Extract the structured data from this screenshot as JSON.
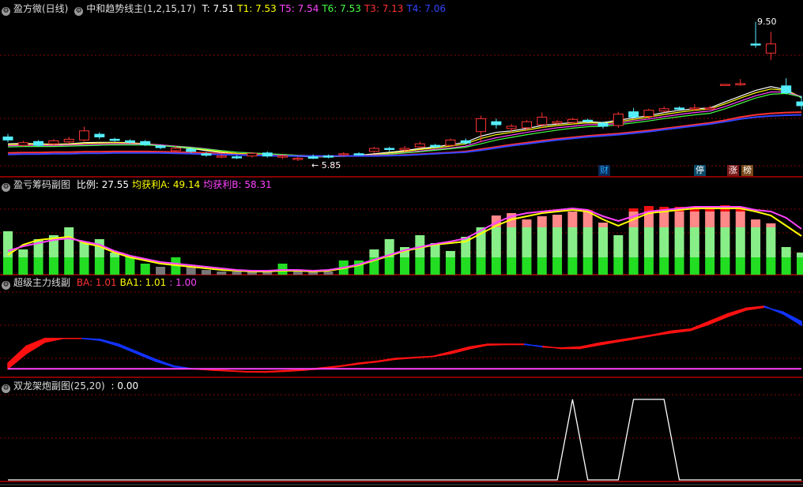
{
  "panel1": {
    "title": "盈方微(日线)",
    "indicator": "中和趋势线主(1,2,15,17)",
    "values": [
      {
        "label": "T: 7.51",
        "color": "#ffffff"
      },
      {
        "label": "T1: 7.53",
        "color": "#ffff00"
      },
      {
        "label": "T5: 7.54",
        "color": "#ff44ff"
      },
      {
        "label": "T6: 7.53",
        "color": "#44ff44"
      },
      {
        "label": "T3: 7.13",
        "color": "#ff3333"
      },
      {
        "label": "T4: 7.06",
        "color": "#3344ff"
      }
    ],
    "high_label": "9.50",
    "low_label": "5.85",
    "tags": [
      {
        "text": "财",
        "color": "#22aaff",
        "bg": "#0a2a55"
      },
      {
        "text": "停",
        "color": "#ffffff",
        "bg": "#0a4a6a"
      },
      {
        "text": "涨",
        "color": "#ffffff",
        "bg": "#7a1a1a"
      },
      {
        "text": "榜",
        "color": "#ffffff",
        "bg": "#7a4a1a"
      }
    ]
  },
  "panel2": {
    "title": "盈亏筹码副图",
    "values": [
      {
        "label": "比例: 27.55",
        "color": "#ffffff"
      },
      {
        "label": "均获利A: 49.14",
        "color": "#ffff00"
      },
      {
        "label": "均获利B: 58.31",
        "color": "#ff44ff"
      }
    ]
  },
  "panel3": {
    "title": "超级主力线副",
    "values": [
      {
        "label": "BA: 1.01",
        "color": "#ff3333"
      },
      {
        "label": "BA1: 1.01",
        "color": "#ffff00"
      },
      {
        "label": ": 1.00",
        "color": "#ff44ff"
      }
    ]
  },
  "panel4": {
    "title": "双龙架炮副图(25,20)",
    "values": [
      {
        "label": ": 0.00",
        "color": "#ffffff"
      }
    ]
  },
  "colors": {
    "up": "#ff3333",
    "down": "#55eeff",
    "grid": "#8a0000",
    "border": "#b00000",
    "ma_white": "#ffffff",
    "ma_yellow": "#ffff00",
    "ma_magenta": "#ff44ff",
    "ma_green": "#44ff44",
    "ma_red": "#ff3333",
    "ma_blue": "#3344ff"
  },
  "chart_data": [
    {
      "type": "candlestick",
      "title": "盈方微(日线)",
      "ylim": [
        5.6,
        9.7
      ],
      "high": 9.5,
      "low": 5.85,
      "candles": [
        [
          6.48,
          6.4,
          6.56,
          6.34
        ],
        [
          6.26,
          6.33,
          6.38,
          6.22
        ],
        [
          6.36,
          6.26,
          6.4,
          6.22
        ],
        [
          6.3,
          6.38,
          6.42,
          6.26
        ],
        [
          6.35,
          6.42,
          6.48,
          6.3
        ],
        [
          6.4,
          6.64,
          6.75,
          6.36
        ],
        [
          6.55,
          6.48,
          6.6,
          6.42
        ],
        [
          6.42,
          6.4,
          6.46,
          6.36
        ],
        [
          6.38,
          6.34,
          6.42,
          6.3
        ],
        [
          6.36,
          6.28,
          6.4,
          6.24
        ],
        [
          6.24,
          6.2,
          6.28,
          6.16
        ],
        [
          6.12,
          6.18,
          6.24,
          6.08
        ],
        [
          6.16,
          6.1,
          6.2,
          6.06
        ],
        [
          6.04,
          6.0,
          6.08,
          5.96
        ],
        [
          5.96,
          5.98,
          6.02,
          5.92
        ],
        [
          5.96,
          5.93,
          6.0,
          5.9
        ],
        [
          5.98,
          6.05,
          6.08,
          5.94
        ],
        [
          6.06,
          5.98,
          6.1,
          5.94
        ],
        [
          5.96,
          5.98,
          6.02,
          5.9
        ],
        [
          5.9,
          5.92,
          5.96,
          5.85
        ],
        [
          5.96,
          5.92,
          6.02,
          5.9
        ],
        [
          5.98,
          5.95,
          6.02,
          5.92
        ],
        [
          6.02,
          6.04,
          6.08,
          5.98
        ],
        [
          6.04,
          6.02,
          6.08,
          6.0
        ],
        [
          6.1,
          6.18,
          6.22,
          6.06
        ],
        [
          6.18,
          6.16,
          6.22,
          6.1
        ],
        [
          6.14,
          6.18,
          6.24,
          6.1
        ],
        [
          6.22,
          6.3,
          6.36,
          6.18
        ],
        [
          6.26,
          6.22,
          6.3,
          6.18
        ],
        [
          6.26,
          6.4,
          6.44,
          6.22
        ],
        [
          6.38,
          6.32,
          6.44,
          6.28
        ],
        [
          6.62,
          6.96,
          7.04,
          6.34
        ],
        [
          6.88,
          6.8,
          6.96,
          6.7
        ],
        [
          6.7,
          6.76,
          6.82,
          6.6
        ],
        [
          6.72,
          6.88,
          6.92,
          6.66
        ],
        [
          6.8,
          7.0,
          7.12,
          6.72
        ],
        [
          6.84,
          6.88,
          6.92,
          6.8
        ],
        [
          6.86,
          6.94,
          6.98,
          6.82
        ],
        [
          6.92,
          6.9,
          6.96,
          6.84
        ],
        [
          6.84,
          6.76,
          6.88,
          6.7
        ],
        [
          6.78,
          7.08,
          7.14,
          6.72
        ],
        [
          7.14,
          7.0,
          7.24,
          6.98
        ],
        [
          7.02,
          7.18,
          7.22,
          6.96
        ],
        [
          7.16,
          7.22,
          7.28,
          7.12
        ],
        [
          7.24,
          7.22,
          7.28,
          7.18
        ],
        [
          7.24,
          7.24,
          7.34,
          7.16
        ],
        [
          7.24,
          7.24,
          7.3,
          7.22
        ],
        [
          7.86,
          7.86,
          7.86,
          7.86
        ],
        [
          7.88,
          7.88,
          8.0,
          7.82
        ],
        [
          8.92,
          8.9,
          9.5,
          8.82
        ],
        [
          8.68,
          8.92,
          9.24,
          8.5
        ],
        [
          7.82,
          7.64,
          8.02,
          7.6
        ],
        [
          7.4,
          7.3,
          7.56,
          7.2
        ]
      ],
      "ma_series": [
        {
          "name": "T",
          "values": [
            6.3,
            6.31,
            6.3,
            6.29,
            6.3,
            6.33,
            6.34,
            6.34,
            6.33,
            6.3,
            6.26,
            6.22,
            6.18,
            6.12,
            6.07,
            6.03,
            6.02,
            6.0,
            5.99,
            5.97,
            5.96,
            5.96,
            5.98,
            6.0,
            6.04,
            6.08,
            6.12,
            6.18,
            6.22,
            6.28,
            6.34,
            6.5,
            6.6,
            6.64,
            6.7,
            6.78,
            6.82,
            6.86,
            6.88,
            6.86,
            6.92,
            6.98,
            7.04,
            7.12,
            7.18,
            7.22,
            7.24,
            7.4,
            7.55,
            7.7,
            7.8,
            7.72,
            7.51
          ]
        },
        {
          "name": "T1",
          "values": [
            6.28,
            6.29,
            6.29,
            6.28,
            6.29,
            6.31,
            6.32,
            6.33,
            6.32,
            6.3,
            6.27,
            6.23,
            6.19,
            6.14,
            6.09,
            6.05,
            6.03,
            6.01,
            6.0,
            5.98,
            5.97,
            5.96,
            5.97,
            5.99,
            6.02,
            6.06,
            6.1,
            6.15,
            6.19,
            6.24,
            6.3,
            6.44,
            6.54,
            6.6,
            6.66,
            6.73,
            6.78,
            6.82,
            6.85,
            6.84,
            6.88,
            6.94,
            7.0,
            7.07,
            7.13,
            7.18,
            7.21,
            7.35,
            7.5,
            7.64,
            7.74,
            7.7,
            7.53
          ]
        },
        {
          "name": "T5",
          "values": [
            6.25,
            6.26,
            6.26,
            6.26,
            6.27,
            6.28,
            6.29,
            6.3,
            6.3,
            6.29,
            6.27,
            6.24,
            6.21,
            6.17,
            6.12,
            6.08,
            6.06,
            6.04,
            6.02,
            6.0,
            5.99,
            5.98,
            5.98,
            5.99,
            6.01,
            6.04,
            6.07,
            6.11,
            6.15,
            6.19,
            6.24,
            6.36,
            6.46,
            6.53,
            6.6,
            6.66,
            6.72,
            6.76,
            6.8,
            6.8,
            6.84,
            6.9,
            6.95,
            7.01,
            7.07,
            7.12,
            7.16,
            7.28,
            7.42,
            7.56,
            7.66,
            7.66,
            7.54
          ]
        },
        {
          "name": "T6",
          "values": [
            6.22,
            6.23,
            6.23,
            6.23,
            6.24,
            6.25,
            6.26,
            6.27,
            6.27,
            6.27,
            6.25,
            6.23,
            6.2,
            6.16,
            6.12,
            6.08,
            6.06,
            6.04,
            6.02,
            6.0,
            5.99,
            5.98,
            5.98,
            5.99,
            6.0,
            6.03,
            6.06,
            6.09,
            6.13,
            6.17,
            6.21,
            6.3,
            6.4,
            6.47,
            6.54,
            6.6,
            6.66,
            6.71,
            6.75,
            6.76,
            6.8,
            6.85,
            6.9,
            6.96,
            7.01,
            7.06,
            7.1,
            7.22,
            7.36,
            7.5,
            7.6,
            7.62,
            7.53
          ]
        },
        {
          "name": "T3",
          "values": [
            6.06,
            6.07,
            6.07,
            6.08,
            6.08,
            6.09,
            6.09,
            6.1,
            6.1,
            6.1,
            6.09,
            6.08,
            6.07,
            6.06,
            6.04,
            6.02,
            6.01,
            6.0,
            5.99,
            5.98,
            5.98,
            5.98,
            5.98,
            5.98,
            5.99,
            6.0,
            6.01,
            6.03,
            6.05,
            6.07,
            6.1,
            6.16,
            6.22,
            6.28,
            6.33,
            6.38,
            6.43,
            6.47,
            6.51,
            6.54,
            6.57,
            6.61,
            6.65,
            6.7,
            6.75,
            6.8,
            6.85,
            6.92,
            7.0,
            7.06,
            7.1,
            7.12,
            7.13
          ]
        },
        {
          "name": "T4",
          "values": [
            6.02,
            6.03,
            6.03,
            6.04,
            6.04,
            6.05,
            6.05,
            6.06,
            6.06,
            6.06,
            6.06,
            6.05,
            6.04,
            6.03,
            6.02,
            6.01,
            6.0,
            5.99,
            5.98,
            5.98,
            5.98,
            5.98,
            5.98,
            5.98,
            5.98,
            5.99,
            6.0,
            6.02,
            6.04,
            6.06,
            6.08,
            6.13,
            6.19,
            6.25,
            6.3,
            6.35,
            6.4,
            6.44,
            6.48,
            6.51,
            6.54,
            6.58,
            6.62,
            6.67,
            6.72,
            6.77,
            6.82,
            6.88,
            6.95,
            7.0,
            7.03,
            7.05,
            7.06
          ]
        }
      ]
    },
    {
      "type": "bar",
      "title": "盈亏筹码副图",
      "ylim": [
        0,
        100
      ],
      "values": [
        55,
        32,
        45,
        50,
        60,
        42,
        45,
        28,
        24,
        14,
        10,
        22,
        10,
        6,
        4,
        4,
        4,
        4,
        14,
        6,
        4,
        4,
        18,
        18,
        32,
        45,
        35,
        50,
        40,
        30,
        48,
        60,
        75,
        78,
        70,
        74,
        76,
        80,
        82,
        66,
        50,
        84,
        87,
        86,
        86,
        86,
        87,
        88,
        86,
        70,
        65,
        35,
        28
      ],
      "series": [
        {
          "name": "均获利A",
          "values": [
            25,
            38,
            44,
            46,
            48,
            40,
            36,
            28,
            22,
            18,
            14,
            12,
            10,
            8,
            6,
            5,
            4,
            4,
            5,
            5,
            4,
            5,
            8,
            12,
            18,
            24,
            30,
            34,
            38,
            40,
            42,
            52,
            62,
            70,
            74,
            78,
            80,
            82,
            80,
            70,
            62,
            70,
            78,
            80,
            82,
            84,
            84,
            84,
            84,
            80,
            75,
            62,
            49
          ]
        },
        {
          "name": "均获利B",
          "values": [
            30,
            36,
            40,
            44,
            46,
            42,
            38,
            30,
            24,
            20,
            16,
            14,
            12,
            10,
            8,
            6,
            5,
            5,
            6,
            6,
            5,
            6,
            9,
            13,
            19,
            25,
            31,
            35,
            39,
            42,
            46,
            56,
            66,
            74,
            78,
            80,
            82,
            84,
            82,
            74,
            68,
            74,
            80,
            82,
            84,
            86,
            86,
            86,
            86,
            82,
            80,
            72,
            58
          ]
        }
      ]
    },
    {
      "type": "area",
      "title": "超级主力线副",
      "ylim": [
        0.6,
        1.05
      ],
      "series": [
        {
          "name": "BA",
          "values": [
            0.65,
            0.74,
            0.78,
            0.78,
            0.78,
            0.77,
            0.74,
            0.7,
            0.66,
            0.63,
            0.62,
            0.615,
            0.61,
            0.605,
            0.605,
            0.61,
            0.615,
            0.625,
            0.635,
            0.65,
            0.66,
            0.675,
            0.68,
            0.685,
            0.71,
            0.735,
            0.75,
            0.75,
            0.75,
            0.735,
            0.73,
            0.735,
            0.755,
            0.77,
            0.785,
            0.8,
            0.82,
            0.83,
            0.87,
            0.91,
            0.94,
            0.95,
            0.91,
            0.85
          ]
        },
        {
          "name": "BA1",
          "values": [
            0.62,
            0.7,
            0.76,
            0.78,
            0.78,
            0.775,
            0.75,
            0.71,
            0.67,
            0.635,
            0.62,
            0.613,
            0.608,
            0.603,
            0.602,
            0.606,
            0.612,
            0.62,
            0.632,
            0.645,
            0.656,
            0.67,
            0.678,
            0.684,
            0.7,
            0.725,
            0.745,
            0.748,
            0.748,
            0.738,
            0.727,
            0.727,
            0.745,
            0.762,
            0.778,
            0.796,
            0.81,
            0.822,
            0.855,
            0.895,
            0.93,
            0.945,
            0.92,
            0.87
          ]
        },
        {
          "name": "BL",
          "values": [
            0.62,
            0.62,
            0.62,
            0.62,
            0.62,
            0.62,
            0.62,
            0.62,
            0.62,
            0.62,
            0.62,
            0.62,
            0.62,
            0.62,
            0.62,
            0.62,
            0.62,
            0.62,
            0.62,
            0.62,
            0.62,
            0.62,
            0.62,
            0.62,
            0.62,
            0.62,
            0.62,
            0.62,
            0.62,
            0.62,
            0.62,
            0.62,
            0.62,
            0.62,
            0.62,
            0.62,
            0.62,
            0.62,
            0.62,
            0.62,
            0.62,
            0.62,
            0.62,
            0.62
          ]
        }
      ]
    },
    {
      "type": "line",
      "title": "双龙架炮副图(25,20)",
      "ylim": [
        0,
        1
      ],
      "values": [
        0,
        0,
        0,
        0,
        0,
        0,
        0,
        0,
        0,
        0,
        0,
        0,
        0,
        0,
        0,
        0,
        0,
        0,
        0,
        0,
        0,
        0,
        0,
        0,
        0,
        0,
        0,
        0,
        0,
        0,
        0,
        0,
        0,
        0,
        0,
        0,
        0,
        1,
        0,
        0,
        0,
        1,
        1,
        1,
        0,
        0,
        0,
        0,
        0,
        0,
        0,
        0,
        0
      ]
    }
  ]
}
